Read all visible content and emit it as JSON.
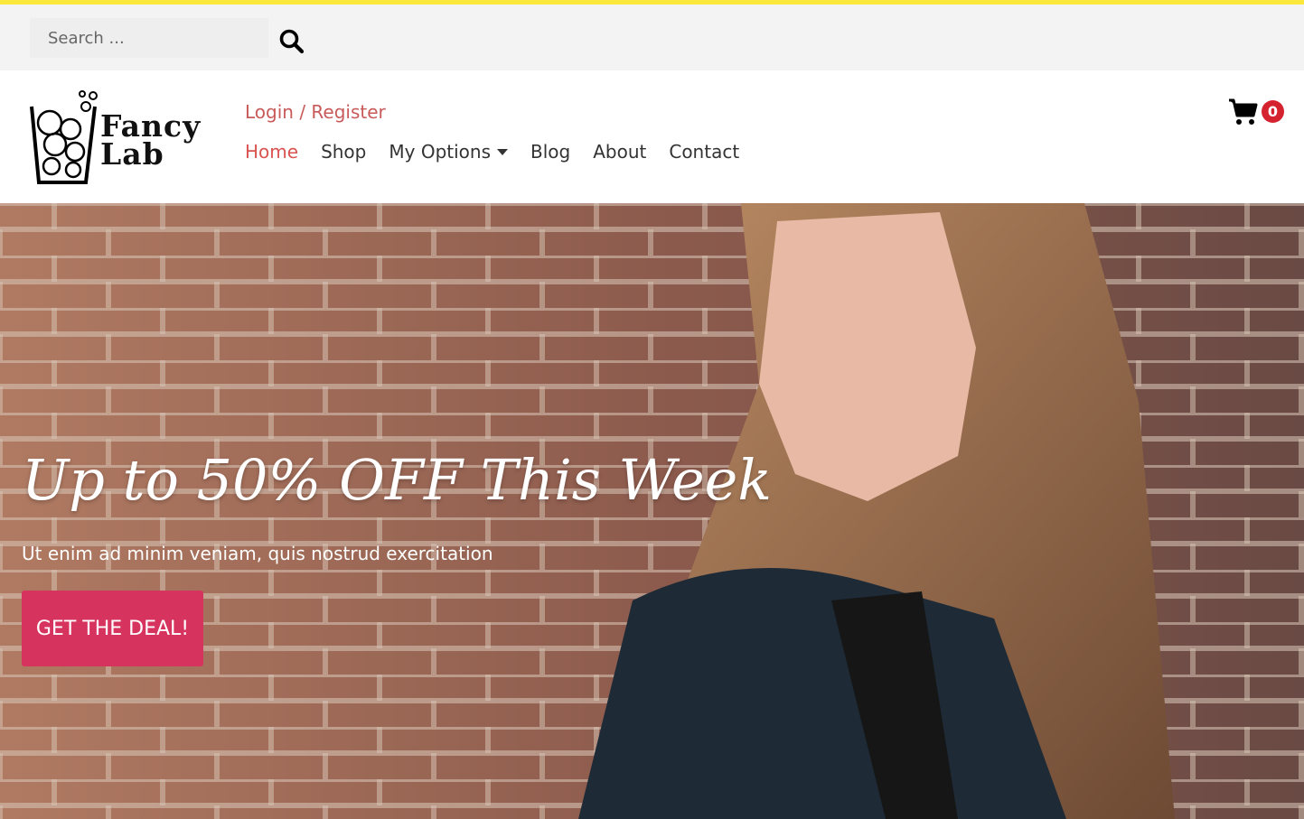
{
  "search": {
    "placeholder": "Search ...",
    "icon": "search-icon"
  },
  "brand": {
    "logo_text": "Fancy Lab"
  },
  "account": {
    "login_label": "Login / Register"
  },
  "nav": {
    "items": [
      {
        "label": "Home"
      },
      {
        "label": "Shop"
      },
      {
        "label": "My Options"
      },
      {
        "label": "Blog"
      },
      {
        "label": "About"
      },
      {
        "label": "Contact"
      }
    ]
  },
  "cart": {
    "count": "0",
    "icon": "shopping-cart-icon"
  },
  "hero": {
    "title": "Up to 50% OFF This Week",
    "subtitle": "Ut enim ad minim veniam, quis nostrud exercitation",
    "cta_label": "GET THE DEAL!"
  },
  "colors": {
    "accent_bar": "#fbe83a",
    "login_link": "#c85a5a",
    "nav_active": "#d9534f",
    "cta": "#d6335e",
    "cart_badge": "#d4232f"
  }
}
